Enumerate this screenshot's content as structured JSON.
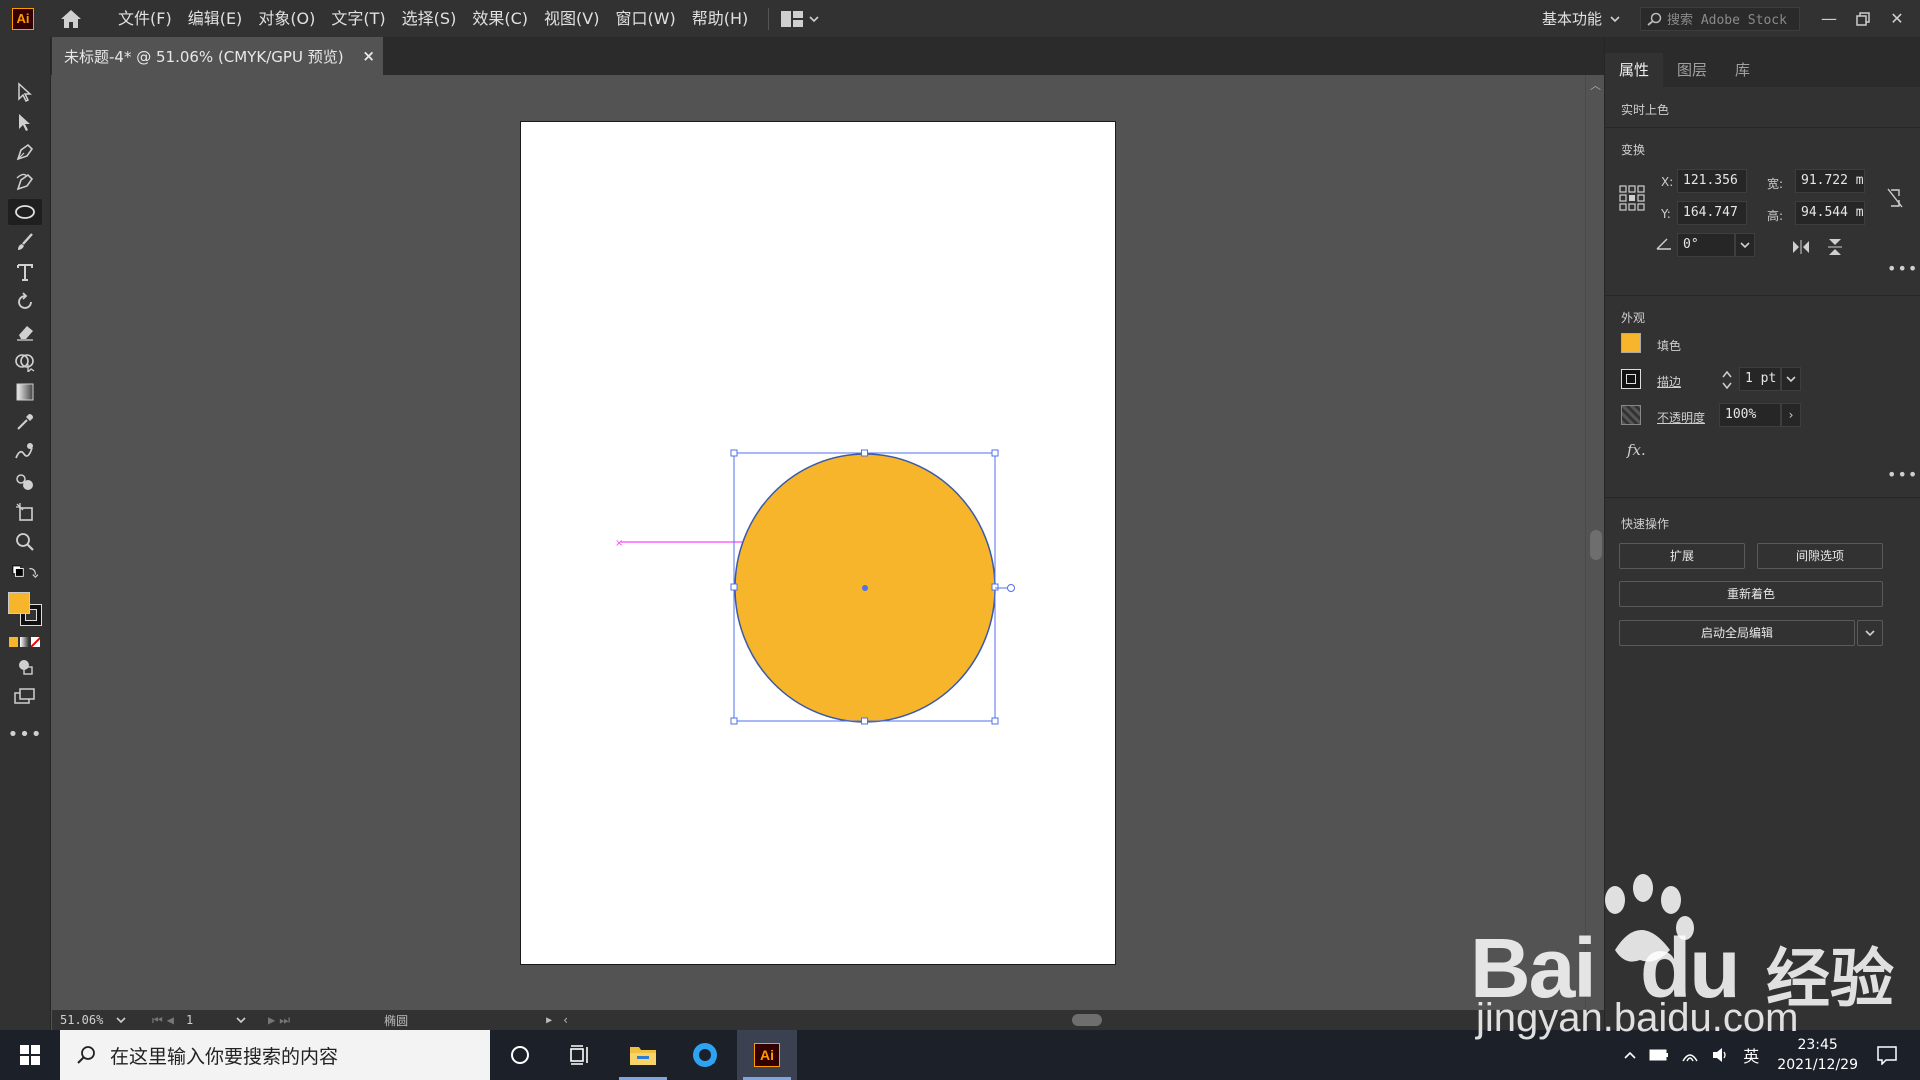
{
  "app": {
    "logo_text": "Ai"
  },
  "menu": {
    "items": [
      "文件(F)",
      "编辑(E)",
      "对象(O)",
      "文字(T)",
      "选择(S)",
      "效果(C)",
      "视图(V)",
      "窗口(W)",
      "帮助(H)"
    ],
    "workspace": "基本功能",
    "stock_search_placeholder": "搜索 Adobe Stock"
  },
  "document_tab": {
    "title": "未标题-4* @ 51.06% (CMYK/GPU 预览)",
    "close": "×"
  },
  "colors": {
    "fill": "#F7B52C",
    "stroke": "#3b5aa8",
    "selection": "#4f72e8",
    "guide": "#ff44ff",
    "accent_logo": "#ff9a00"
  },
  "panel": {
    "tabs": [
      "属性",
      "图层",
      "库"
    ],
    "live_paint": "实时上色",
    "transform": {
      "title": "变换",
      "x_label": "X:",
      "x_value": "121.356",
      "y_label": "Y:",
      "y_value": "164.747",
      "w_label": "宽:",
      "w_value": "91.722 m",
      "h_label": "高:",
      "h_value": "94.544 m",
      "angle_value": "0°"
    },
    "appearance": {
      "title": "外观",
      "fill_label": "填色",
      "stroke_label": "描边",
      "stroke_value": "1 pt",
      "opacity_label": "不透明度",
      "opacity_value": "100%",
      "fx_label": "fx."
    },
    "quick_actions": {
      "title": "快速操作",
      "expand": "扩展",
      "isolation": "间隙选项",
      "recolor": "重新着色",
      "global_edit": "启动全局编辑"
    }
  },
  "status": {
    "zoom": "51.06%",
    "artboard_number": "1",
    "object_type": "椭圆"
  },
  "taskbar": {
    "search_placeholder": "在这里输入你要搜索的内容",
    "ime": "英",
    "time": "23:45",
    "date": "2021/12/29",
    "ai_label": "Ai"
  },
  "watermark": {
    "brand": "Bai",
    "brand2": "du",
    "cn": "经验",
    "url": "jingyan.baidu.com"
  }
}
